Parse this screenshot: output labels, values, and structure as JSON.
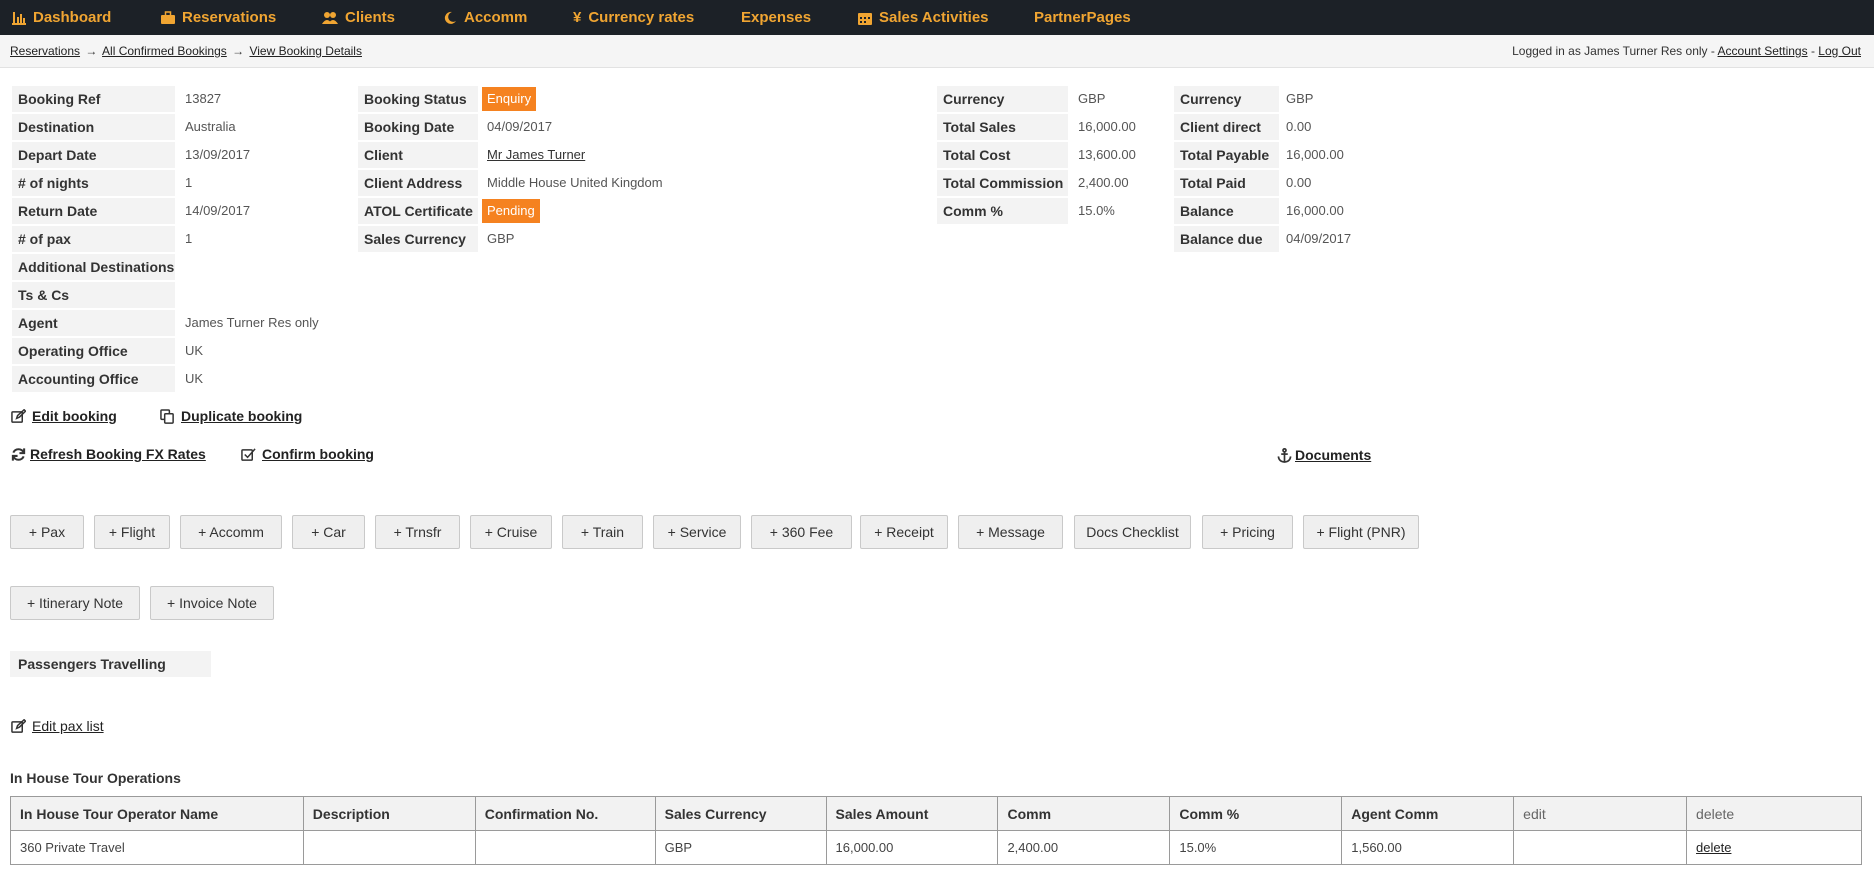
{
  "nav": {
    "dashboard": "Dashboard",
    "reservations": "Reservations",
    "clients": "Clients",
    "accomm": "Accomm",
    "currency_rates": "Currency rates",
    "expenses": "Expenses",
    "sales_activities": "Sales Activities",
    "partner_pages": "PartnerPages"
  },
  "breadcrumb": {
    "items": [
      "Reservations",
      "All Confirmed Bookings",
      "View Booking Details"
    ],
    "separator": "→"
  },
  "user": {
    "logged_in_text": "Logged in as James Turner Res only -",
    "account_settings": "Account Settings",
    "dash": "-",
    "logout": "Log Out"
  },
  "booking": {
    "booking_ref": {
      "label": "Booking Ref",
      "value": "13827"
    },
    "destination": {
      "label": "Destination",
      "value": "Australia"
    },
    "depart_date": {
      "label": "Depart Date",
      "value": "13/09/2017"
    },
    "nights": {
      "label": "# of nights",
      "value": "1"
    },
    "return_date": {
      "label": "Return Date",
      "value": "14/09/2017"
    },
    "pax": {
      "label": "# of pax",
      "value": "1"
    },
    "additional_destinations": {
      "label": "Additional Destinations",
      "value": ""
    },
    "ts_cs": {
      "label": "Ts & Cs",
      "value": ""
    },
    "agent": {
      "label": "Agent",
      "value": "James Turner Res only"
    },
    "operating_office": {
      "label": "Operating Office",
      "value": "UK"
    },
    "accounting_office": {
      "label": "Accounting Office",
      "value": "UK"
    }
  },
  "status": {
    "booking_status": {
      "label": "Booking Status",
      "value": "Enquiry"
    },
    "booking_date": {
      "label": "Booking Date",
      "value": "04/09/2017"
    },
    "client": {
      "label": "Client",
      "value": "Mr James Turner"
    },
    "client_address": {
      "label": "Client Address",
      "value": "Middle House United Kingdom"
    },
    "atol": {
      "label": "ATOL Certificate",
      "value": "Pending"
    },
    "sales_currency": {
      "label": "Sales Currency",
      "value": "GBP"
    }
  },
  "finance_sales": {
    "currency": {
      "label": "Currency",
      "value": "GBP"
    },
    "total_sales": {
      "label": "Total Sales",
      "value": "16,000.00"
    },
    "total_cost": {
      "label": "Total Cost",
      "value": "13,600.00"
    },
    "total_commission": {
      "label": "Total Commission",
      "value": "2,400.00"
    },
    "comm_pct": {
      "label": "Comm %",
      "value": "15.0%"
    }
  },
  "finance_client": {
    "currency": {
      "label": "Currency",
      "value": "GBP"
    },
    "client_direct": {
      "label": "Client direct",
      "value": "0.00"
    },
    "total_payable": {
      "label": "Total Payable",
      "value": "16,000.00"
    },
    "total_paid": {
      "label": "Total Paid",
      "value": "0.00"
    },
    "balance": {
      "label": "Balance",
      "value": "16,000.00"
    },
    "balance_due": {
      "label": "Balance due",
      "value": "04/09/2017"
    }
  },
  "actions": {
    "edit_booking": "Edit booking",
    "duplicate_booking": "Duplicate booking",
    "refresh_fx": "Refresh Booking FX Rates",
    "confirm_booking": "Confirm booking",
    "documents": " Documents"
  },
  "buttons": {
    "pax": "+ Pax",
    "flight": "+ Flight",
    "accomm": "+ Accomm",
    "car": "+ Car",
    "trnsfr": "+ Trnsfr",
    "cruise": "+ Cruise",
    "train": "+ Train",
    "service": "+ Service",
    "fee360": "+ 360 Fee",
    "receipt": "+ Receipt",
    "message": "+ Message",
    "docs_checklist": "Docs Checklist",
    "pricing": "+ Pricing",
    "flight_pnr": "+ Flight (PNR)",
    "itinerary_note": "+ Itinerary Note",
    "invoice_note": "+ Invoice Note"
  },
  "passengers": {
    "heading": "Passengers Travelling",
    "edit_pax_list": "Edit pax list"
  },
  "tour_ops": {
    "heading": "In House Tour Operations",
    "columns": [
      "In House Tour Operator Name",
      "Description",
      "Confirmation No.",
      "Sales Currency",
      "Sales Amount",
      "Comm",
      "Comm %",
      "Agent Comm",
      "edit",
      "delete"
    ],
    "rows": [
      [
        "360 Private Travel",
        "",
        "",
        "GBP",
        "16,000.00",
        "2,400.00",
        "15.0%",
        "1,560.00",
        "",
        "delete"
      ]
    ]
  }
}
